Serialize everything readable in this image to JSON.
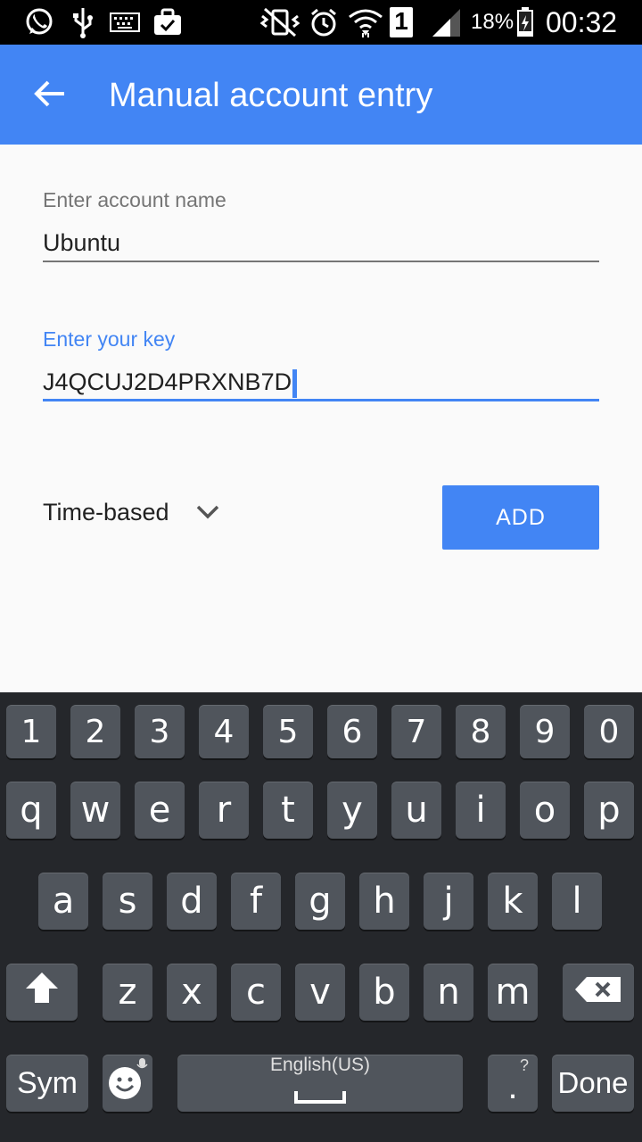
{
  "status_bar": {
    "battery_percent": "18%",
    "time": "00:32",
    "sim_slot": "1"
  },
  "app_bar": {
    "title": "Manual account entry"
  },
  "form": {
    "account_label": "Enter account name",
    "account_value": "Ubuntu",
    "key_label": "Enter your key",
    "key_value": "J4QCUJ2D4PRXNB7D",
    "type_value": "Time-based",
    "add_label": "ADD"
  },
  "keyboard": {
    "number_row": [
      "1",
      "2",
      "3",
      "4",
      "5",
      "6",
      "7",
      "8",
      "9",
      "0"
    ],
    "row1": [
      "q",
      "w",
      "e",
      "r",
      "t",
      "y",
      "u",
      "i",
      "o",
      "p"
    ],
    "row2": [
      "a",
      "s",
      "d",
      "f",
      "g",
      "h",
      "j",
      "k",
      "l"
    ],
    "row3": [
      "z",
      "x",
      "c",
      "v",
      "b",
      "n",
      "m"
    ],
    "sym_label": "Sym",
    "space_label": "English(US)",
    "period_label": ".",
    "period_hint": "?",
    "done_label": "Done"
  },
  "colors": {
    "accent": "#4285f4",
    "keyboard_bg": "#25272b",
    "key_bg": "#50555c"
  }
}
